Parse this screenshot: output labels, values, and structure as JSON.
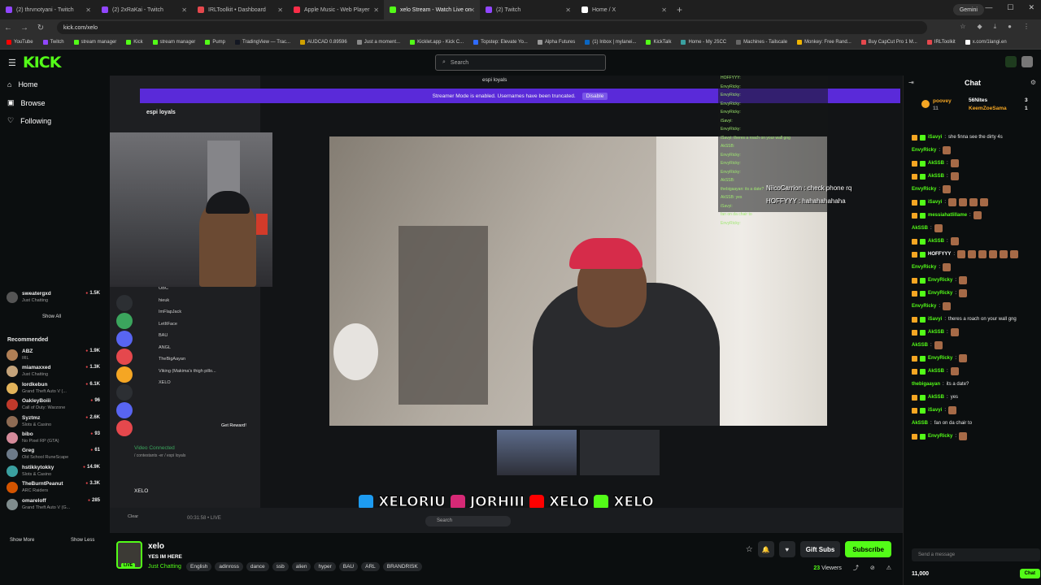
{
  "browser": {
    "tabs": [
      {
        "label": "(2) thrvnotyani - Twitch",
        "color": "#9146ff"
      },
      {
        "label": "(2) 2xRaKai - Twitch",
        "color": "#9146ff"
      },
      {
        "label": "IRLToolkit • Dashboard",
        "color": "#e5484d"
      },
      {
        "label": "Apple Music - Web Player",
        "color": "#fa2d48"
      },
      {
        "label": "xelo Stream - Watch Live on",
        "color": "#53fc18"
      },
      {
        "label": "(2) Twitch",
        "color": "#9146ff"
      },
      {
        "label": "Home / X",
        "color": "#ffffff"
      }
    ],
    "gemini": "Gemini",
    "url": "kick.com/xelo",
    "bookmarks": [
      "YouTube",
      "Twitch",
      "stream manager",
      "Kick",
      "stream manager",
      "Pump",
      "TradingView — Trac...",
      "AUDCAD 0.89596",
      "Just a moment...",
      "Kicklet.app - Kick C...",
      "Topstep: Elevate Yo...",
      "Alpha Futures",
      "(1) Inbox | mylanei...",
      "KickTalk",
      "Home - My JSCC",
      "Machines - Tailscale",
      "Monkey: Free Rand...",
      "Buy CapCut Pro 1 M...",
      "IRLToolkit",
      "x.com/1langi.en"
    ]
  },
  "kick": {
    "logo": "KICK",
    "search_placeholder": "Search"
  },
  "sidebar": {
    "nav": [
      "Home",
      "Browse",
      "Following"
    ],
    "following_item": {
      "name": "sweatergxd",
      "category": "Just Chatting",
      "viewers": "1.5K"
    },
    "show_all": "Show All",
    "recommended_title": "Recommended",
    "recommended": [
      {
        "name": "ABZ",
        "category": "IRL",
        "viewers": "1.9K",
        "color": "#b07f55"
      },
      {
        "name": "miamaxxed",
        "category": "Just Chatting",
        "viewers": "1.3K",
        "color": "#c4a37a"
      },
      {
        "name": "lordkebun",
        "category": "Grand Theft Auto V (...",
        "viewers": "6.1K",
        "color": "#e2b35a"
      },
      {
        "name": "OakleyBoiii",
        "category": "Call of Duty: Warzone",
        "viewers": "96",
        "color": "#c0392b"
      },
      {
        "name": "Syztmz",
        "category": "Slots & Casino",
        "viewers": "2.6K",
        "color": "#8e6b53"
      },
      {
        "name": "bibo",
        "category": "No Pixel RP (GTA)",
        "viewers": "93",
        "color": "#d48a9a"
      },
      {
        "name": "Greg",
        "category": "Old School RuneScape",
        "viewers": "61",
        "color": "#6c7a89"
      },
      {
        "name": "hstikkytokky",
        "category": "Slots & Casino",
        "viewers": "14.9K",
        "color": "#3aa0a0"
      },
      {
        "name": "TheBurntPeanut",
        "category": "ARC Raiders",
        "viewers": "3.3K",
        "color": "#d35400"
      },
      {
        "name": "omareloff",
        "category": "Grand Theft Auto V (G...",
        "viewers": "285",
        "color": "#7f8c8d"
      }
    ],
    "show_more": "Show More",
    "show_less": "Show Less"
  },
  "stream": {
    "discord_server": "espi loyals",
    "discord_top": "espi loyals",
    "streamer_mode_text": "Streamer Mode is enabled. Usernames have been truncated.",
    "disable_label": "Disable",
    "voice_users": [
      "OBC",
      "hieuk",
      "ImFlapJack",
      "LetItFace",
      "BAU",
      "ANGL",
      "TheBigAayan",
      "Viking (Makima's thigh pillo...",
      "XELO"
    ],
    "get_reward": "Get Reward!",
    "video_connected": "Video Connected",
    "channel_path": "/ contestants -er / espi loyals",
    "user_name": "XELO",
    "overlay_chat": [
      "HOFFYYY:",
      "EnvyRicky:",
      "EnvyRicky:",
      "EnvyRicky:",
      "EnvyRicky:",
      "iSavyi:",
      "EnvyRicky:",
      "iSavyi: theres a roach on your wall gng",
      "AkSSB:",
      "EnvyRicky:",
      "EnvyRicky:",
      "EnvyRicky:",
      "AkSSB:",
      "thebigaayan: its a date?",
      "AkSSB: yes",
      "iSavyi:",
      "fan on da chair to",
      "EnvyRicky:"
    ],
    "big_chat_1": "NiicoCarrion : check phone rq",
    "big_chat_2": "HOFFYYY : hahahahahaha",
    "socials": [
      "XELORIU",
      "JORHIII",
      "XELO",
      "XELO"
    ],
    "taskbar_search": "Search",
    "taskbar_clear": "Clear",
    "taskbar_time": "00:31:58  •  LIVE"
  },
  "chat": {
    "title": "Chat",
    "pinned": [
      {
        "user": "poovey",
        "count": "11"
      },
      {
        "user": "56Nites",
        "count": "3"
      },
      {
        "user": "KeemZoeSama",
        "count": "1"
      }
    ],
    "messages": [
      {
        "user": "iSavyi",
        "color": "#53fc18",
        "text": "she finna see the dirty 4s"
      },
      {
        "user": "EnvyRicky",
        "color": "#53fc18",
        "text": ""
      },
      {
        "user": "AkSSB",
        "color": "#53fc18",
        "text": ""
      },
      {
        "user": "AkSSB",
        "color": "#53fc18",
        "text": ""
      },
      {
        "user": "EnvyRicky",
        "color": "#53fc18",
        "text": ""
      },
      {
        "user": "iSavyi",
        "color": "#53fc18",
        "text": ""
      },
      {
        "user": "messiahatlillame",
        "color": "#53fc18",
        "text": ""
      },
      {
        "user": "AkSSB",
        "color": "#53fc18",
        "text": ""
      },
      {
        "user": "AkSSB",
        "color": "#53fc18",
        "text": ""
      },
      {
        "user": "HOFFYYY",
        "color": "#ffffff",
        "text": ""
      },
      {
        "user": "EnvyRicky",
        "color": "#53fc18",
        "text": ""
      },
      {
        "user": "EnvyRicky",
        "color": "#53fc18",
        "text": ""
      },
      {
        "user": "EnvyRicky",
        "color": "#53fc18",
        "text": ""
      },
      {
        "user": "EnvyRicky",
        "color": "#53fc18",
        "text": ""
      },
      {
        "user": "iSavyi",
        "color": "#53fc18",
        "text": "theres a roach on your wall gng"
      },
      {
        "user": "AkSSB",
        "color": "#53fc18",
        "text": ""
      },
      {
        "user": "AkSSB",
        "color": "#53fc18",
        "text": ""
      },
      {
        "user": "EnvyRicky",
        "color": "#53fc18",
        "text": ""
      },
      {
        "user": "AkSSB",
        "color": "#53fc18",
        "text": ""
      },
      {
        "user": "thebigaayan",
        "color": "#53fc18",
        "text": "its a date?"
      },
      {
        "user": "AkSSB",
        "color": "#53fc18",
        "text": "yes"
      },
      {
        "user": "iSavyi",
        "color": "#53fc18",
        "text": ""
      },
      {
        "user": "AkSSB",
        "color": "#53fc18",
        "text": "fan on da chair to"
      },
      {
        "user": "EnvyRicky",
        "color": "#53fc18",
        "text": ""
      }
    ],
    "input_placeholder": "Send a message",
    "points": "11,000",
    "send_label": "Chat"
  },
  "channel": {
    "name": "xelo",
    "title": "YES IM HERE",
    "category": "Just Chatting",
    "live": "LIVE",
    "tags": [
      "English",
      "adinross",
      "dance",
      "ssb",
      "alien",
      "hyper",
      "BAU",
      "ARL",
      "BRANDRISK"
    ],
    "gift_subs": "Gift Subs",
    "subscribe": "Subscribe",
    "viewers": "23",
    "viewers_label": "Viewers"
  },
  "colors": {
    "accent": "#53fc18",
    "purple_bar": "#5a2ad9"
  }
}
